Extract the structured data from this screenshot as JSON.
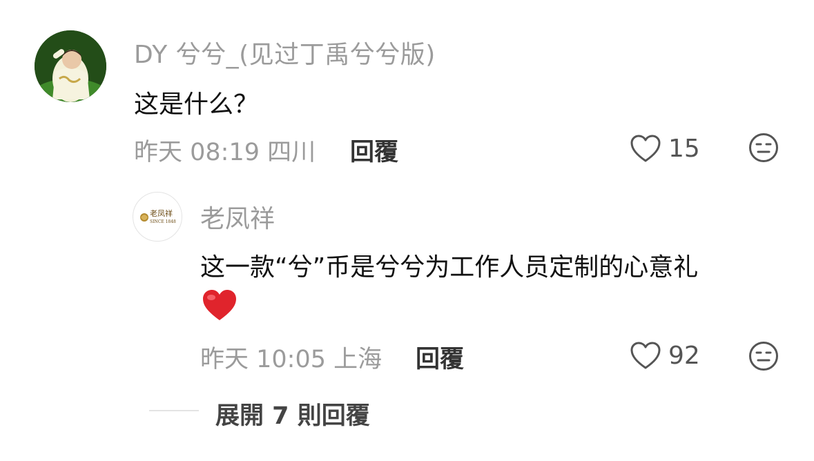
{
  "comment": {
    "username": "DY 兮兮_(见过丁禹兮兮版)",
    "text": "这是什么？",
    "time": "昨天 08:19 四川",
    "reply_label": "回覆",
    "likes": "15"
  },
  "reply": {
    "username": "老凤祥",
    "avatar_logo_text": "老凤祥",
    "avatar_logo_sub": "SINCE 1848",
    "text": "这一款“兮”币是兮兮为工作人员定制的心意礼",
    "emoji": "red-heart",
    "time": "昨天 10:05 上海",
    "reply_label": "回覆",
    "likes": "92"
  },
  "expand": {
    "label": "展開 7 則回覆"
  },
  "colors": {
    "muted": "#9b9b9b",
    "text": "#111111",
    "heart": "#e0242c"
  }
}
